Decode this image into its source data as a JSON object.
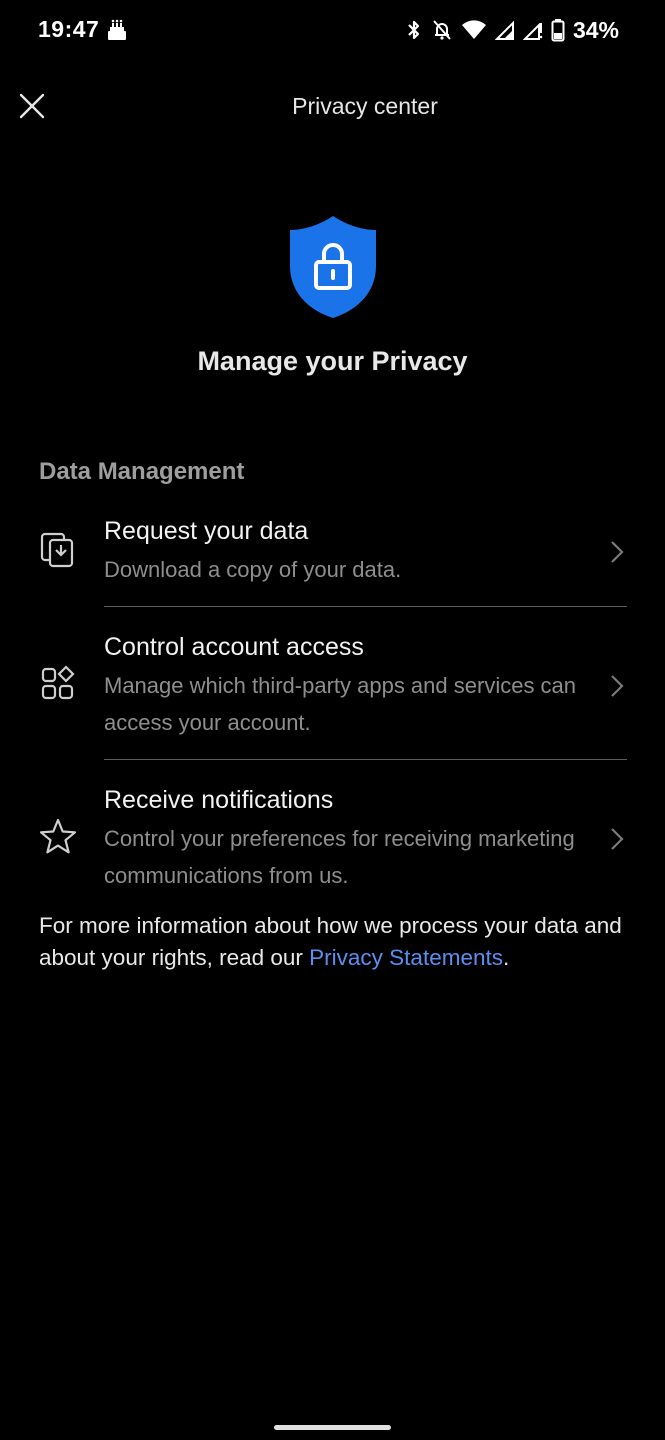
{
  "status_bar": {
    "time": "19:47",
    "battery_percent": "34%"
  },
  "app_bar": {
    "title": "Privacy center"
  },
  "hero": {
    "title": "Manage your Privacy",
    "shield_color": "#1a73e8"
  },
  "section": {
    "heading": "Data Management",
    "items": [
      {
        "icon": "data-export-icon",
        "title": "Request your data",
        "subtitle": "Download a copy of your data."
      },
      {
        "icon": "apps-grid-icon",
        "title": "Control account access",
        "subtitle": "Manage which third-party apps and services can access your account."
      },
      {
        "icon": "star-icon",
        "title": "Receive notifications",
        "subtitle": "Control your preferences for receiving marketing communications from us."
      }
    ]
  },
  "footer": {
    "text_before_link": "For more information about how we process your data and about your rights, read our ",
    "link_text": "Privacy Statements",
    "text_after_link": ".",
    "link_color": "#5b8ef0"
  }
}
